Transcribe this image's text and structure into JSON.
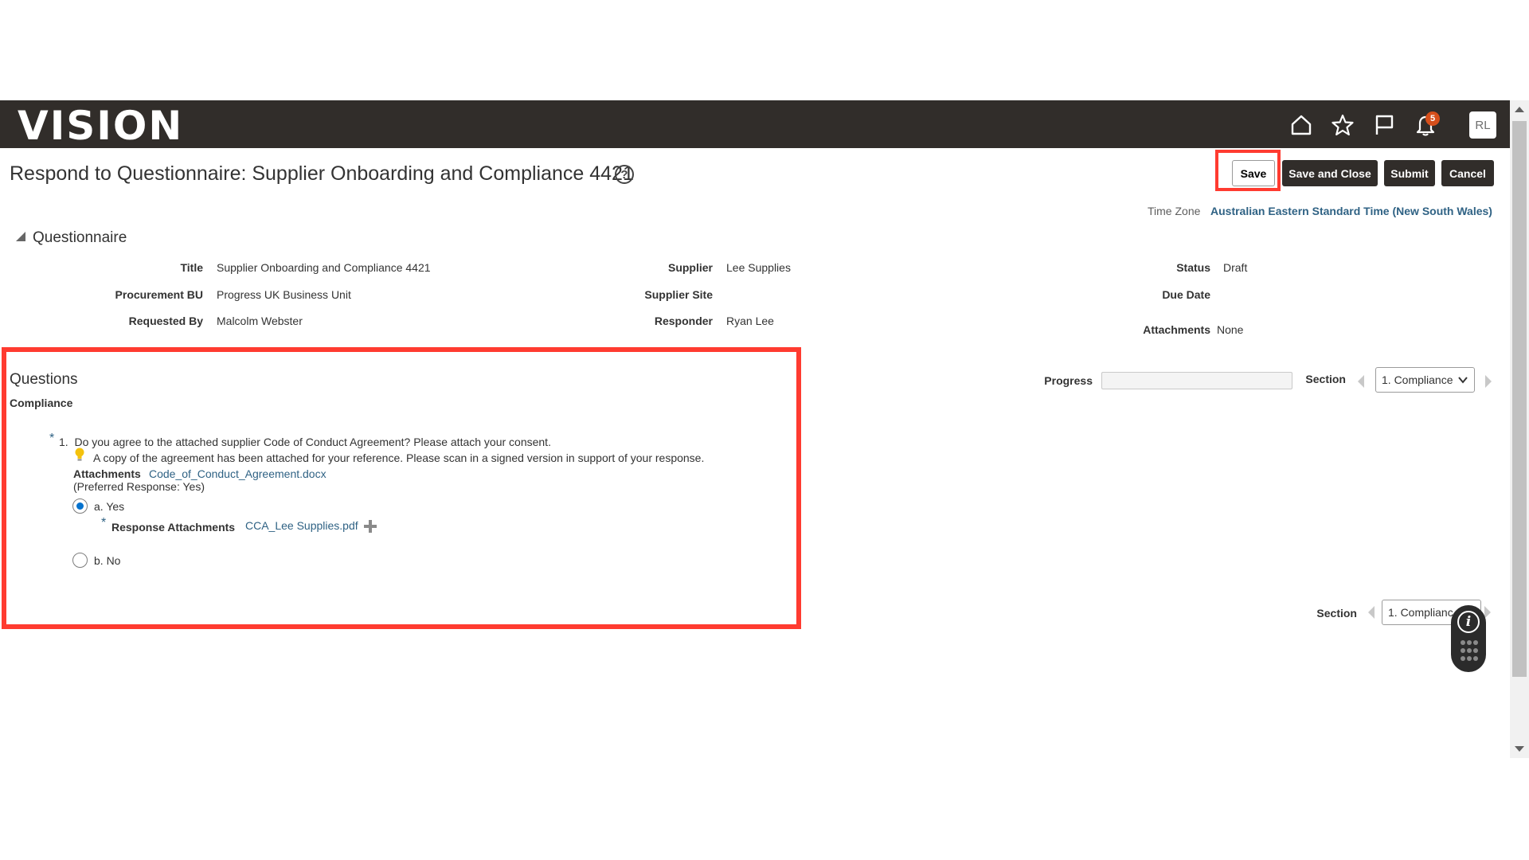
{
  "header": {
    "logo": "VISION",
    "icons": [
      "home-icon",
      "star-icon",
      "flag-icon",
      "bell-icon"
    ],
    "notification_count": "5",
    "user_initials": "RL"
  },
  "page": {
    "title": "Respond to Questionnaire: Supplier Onboarding and Compliance 4421",
    "help": "?"
  },
  "actions": {
    "save": "Save",
    "save_close": "Save and Close",
    "submit": "Submit",
    "cancel": "Cancel"
  },
  "timezone": {
    "label": "Time Zone",
    "value": "Australian Eastern Standard Time (New South Wales)"
  },
  "questionnaire": {
    "section_title": "Questionnaire",
    "fields": {
      "title_label": "Title",
      "title_value": "Supplier Onboarding and Compliance 4421",
      "bu_label": "Procurement BU",
      "bu_value": "Progress UK Business Unit",
      "requested_by_label": "Requested By",
      "requested_by_value": "Malcolm Webster",
      "supplier_label": "Supplier",
      "supplier_value": "Lee Supplies",
      "supplier_site_label": "Supplier Site",
      "responder_label": "Responder",
      "responder_value": "Ryan Lee",
      "status_label": "Status",
      "status_value": "Draft",
      "due_date_label": "Due Date",
      "attachments_label": "Attachments",
      "attachments_value": "None"
    }
  },
  "questions": {
    "heading": "Questions",
    "section_name": "Compliance",
    "progress_label": "Progress",
    "section_label": "Section",
    "section_selected": "1. Compliance",
    "section_selected_bottom": "1. Complianc",
    "items": [
      {
        "number": "1.",
        "text": "Do you agree to the attached supplier Code of Conduct Agreement?  Please attach your consent.",
        "hint": "A copy of the agreement has been attached for your reference. Please scan in a signed version in support of your response.",
        "attachments_label": "Attachments",
        "attachment_file": "Code_of_Conduct_Agreement.docx",
        "preferred": "(Preferred Response: Yes)",
        "options": [
          {
            "label": "a. Yes",
            "selected": true
          },
          {
            "label": "b. No",
            "selected": false
          }
        ],
        "response_attachments_label": "Response Attachments",
        "response_attachment_file": "CCA_Lee Supplies.pdf"
      }
    ]
  },
  "colors": {
    "header_bg": "#312d2a",
    "link": "#2f6284",
    "highlight": "#ff3b30",
    "radio_selected": "#0572ce",
    "badge": "#d64f1b"
  }
}
